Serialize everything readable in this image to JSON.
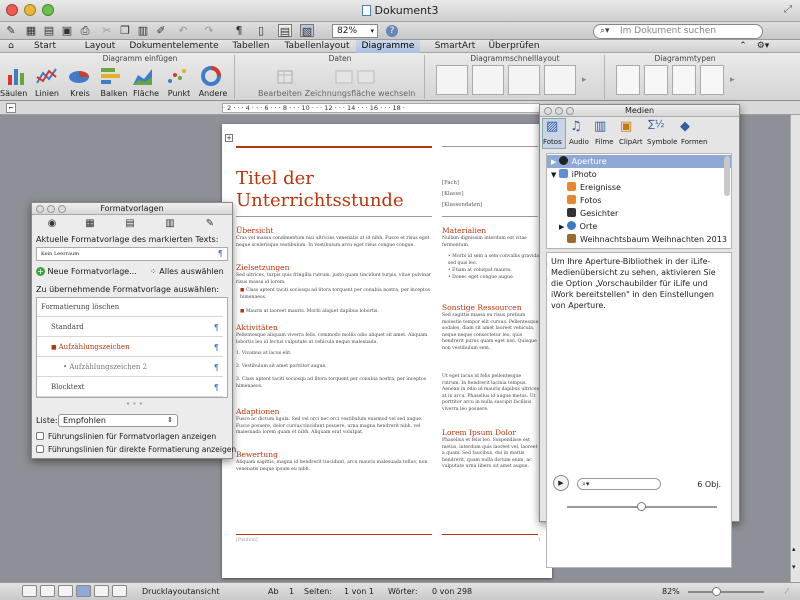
{
  "window": {
    "title": "Dokument3"
  },
  "toolbar": {
    "zoom": "82%",
    "search_placeholder": "Im Dokument suchen"
  },
  "tabs": [
    "Start",
    "Layout",
    "Dokumentelemente",
    "Tabellen",
    "Tabellenlayout",
    "Diagramme",
    "SmartArt",
    "Überprüfen"
  ],
  "active_tab": "Diagramme",
  "ribbon": {
    "group_insert": "Diagramm einfügen",
    "group_data": "Daten",
    "group_quick": "Diagrammschnelllayout",
    "group_types": "Diagrammtypen",
    "buttons": [
      "Säulen",
      "Linien",
      "Kreis",
      "Balken",
      "Fläche",
      "Punkt",
      "Andere"
    ],
    "data_buttons": [
      "Bearbeiten",
      "Zeichnungsfläche wechseln"
    ]
  },
  "ruler": {
    "ticks": "· 2 · · · 4 · · · 6 · · · 8 · · · 10 · · · 12 · · · 14 · · · 16 · · · 18 ·"
  },
  "document": {
    "title": "Titel der Unterrichtsstunde",
    "fields": [
      "[Fach]",
      "[Klasse]",
      "[Klassendaten]"
    ],
    "left_col": [
      {
        "h": "Übersicht",
        "p": "Cras vel massa condimentum nisi ultricies venenatis at id nibh. Fusce et risus eget neque scelerisque vestibulum. In vestibulum arcu eget risus congue congue."
      },
      {
        "h": "Zielsetzungen",
        "p": "Sed ultrices, turpis quis fringilla rutrum, justo quam tincidunt turpis, vitae pulvinar risus massa id lorem."
      },
      {
        "h": "Aktivitäten",
        "p": "Pellentesque aliquam viverra felis, commodo mollis odio aliquet sit amet. Aliquam lobortis leo id lectus vulputate ut vehicula neque malesuada."
      },
      {
        "h": "Adaptionen",
        "p": "Fusce ac dictum ligula. Sed vel orci nec orci vestibulum euismod vel sed augue. Fusce posuere, dolor cursus tincidunt posuere, urna magna hendrerit nibh, vel malesuada lorem quam et nibh. Aliquam erat volutpat."
      },
      {
        "h": "Bewertung",
        "p": "Aliquam sagittis, magna id hendrerit tincidunt, arcu mauris malesuada tellus, non venenatis neque ipsum eu nibh."
      }
    ],
    "zielsetzungen_bullets": [
      "Class aptent taciti sociosqu ad litora torquent per conubia nostra, per inceptos himenaeos.",
      "Mauris at laoreet mauris. Morbi aliquet dapibus lobortis."
    ],
    "aktivitaeten_list": [
      "1. Vivamus at lacus elit.",
      "2. Vestibulum sit amet porttitor augue.",
      "3. Class aptent taciti sociosqu ad litora torquent per conubia nostra, per inceptos himenaeos."
    ],
    "right_col": [
      {
        "h": "Materialien",
        "p": "Nullam dignissim interdum est vitae fermentum."
      },
      {
        "h": "Sonstige Ressourcen",
        "p": "Sed sagittis massa eu risus pretium molestie tempor elit cursus. Pellentesque sodales, diam sit amet laoreet vehicula, neque neque consectetur leo, quis hendrerit purus quam eget nisi. Quisque non vestibulum sem."
      },
      {
        "h": "Lorem Ipsum Dolor",
        "p": "Phasellus et felis leo. Suspendisse est metus, interdum quis laoreet vel, laoreet a quam. Sed faucibus, dui in mattis hendrerit, quam nulla dictum enim, ac vulputate urna libero sit amet augue."
      }
    ],
    "materialien_bullets": [
      "Morbi id sem a sem convallis gravida sed quis leo.",
      "Etiam at volutpat mauris.",
      "Donec eget congue augue."
    ],
    "ressourcen_extra": "Ut eget lacus id felis pellentesque rutrum. In hendrerit lacinia tempus. Aenean in odio id mauris dapibus ultrices at in arcu. Phasellus id augue metus. Ut porttitor arcu in nulla suscipit facilisis viverra leo posuere.",
    "footer_left": "[Position]",
    "footer_right": "1"
  },
  "formatvorlagen": {
    "title": "Formatvorlagen",
    "current_label": "Aktuelle Formatvorlage des markierten Texts:",
    "current_value": "Kein Leerraum",
    "new_label": "Neue Formatvorlage...",
    "select_all": "Alles auswählen",
    "apply_label": "Zu übernehmende Formatvorlage auswählen:",
    "styles": [
      "Formatierung löschen",
      "Standard",
      "Aufzählungszeichen",
      "Aufzählungszeichen 2",
      "Blocktext"
    ],
    "list_label": "Liste:",
    "list_value": "Empfohlen",
    "opt1": "Führungslinien für Formatvorlagen anzeigen",
    "opt2": "Führungslinien für direkte Formatierung anzeigen"
  },
  "medien": {
    "title": "Medien",
    "tabs": [
      "Fotos",
      "Audio",
      "Filme",
      "ClipArt",
      "Symbole",
      "Formen"
    ],
    "tree": [
      "Aperture",
      "iPhoto",
      "Ereignisse",
      "Fotos",
      "Gesichter",
      "Orte",
      "Weihnachtsbaum Weihnachten 2013"
    ],
    "description": "Um Ihre Aperture-Bibliothek in der iLife-Medienübersicht zu sehen, aktivieren Sie die Option „Vorschaubilder für iLife und iWork bereitstellen\" in den Einstellungen von Aperture.",
    "count": "6 Obj."
  },
  "status": {
    "view": "Drucklayoutansicht",
    "ab_label": "Ab",
    "ab_value": "1",
    "pages_label": "Seiten:",
    "pages_value": "1 von 1",
    "words_label": "Wörter:",
    "words_value": "0 von 298",
    "zoom": "82%"
  },
  "colors": {
    "accent": "#b8340c",
    "selection": "#8fa9d6"
  }
}
